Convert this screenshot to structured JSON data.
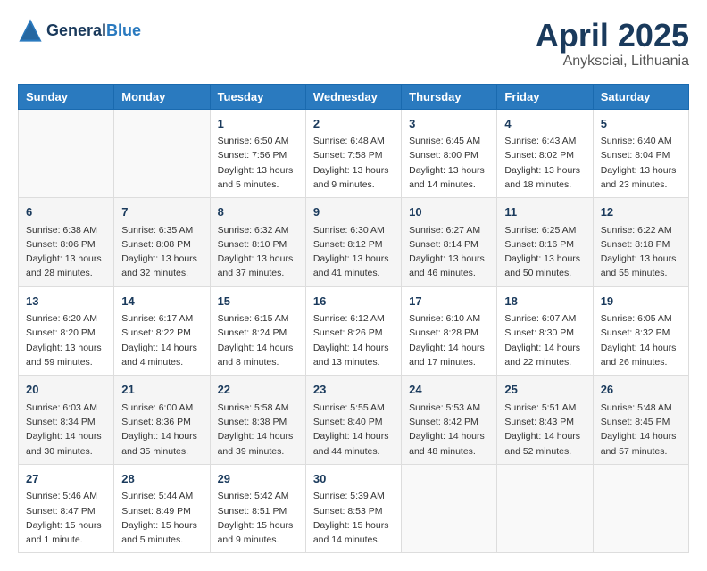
{
  "header": {
    "logo_general": "General",
    "logo_blue": "Blue",
    "month_title": "April 2025",
    "subtitle": "Anyksciai, Lithuania"
  },
  "days_of_week": [
    "Sunday",
    "Monday",
    "Tuesday",
    "Wednesday",
    "Thursday",
    "Friday",
    "Saturday"
  ],
  "weeks": [
    [
      {
        "day": "",
        "info": ""
      },
      {
        "day": "",
        "info": ""
      },
      {
        "day": "1",
        "info": "Sunrise: 6:50 AM\nSunset: 7:56 PM\nDaylight: 13 hours and 5 minutes."
      },
      {
        "day": "2",
        "info": "Sunrise: 6:48 AM\nSunset: 7:58 PM\nDaylight: 13 hours and 9 minutes."
      },
      {
        "day": "3",
        "info": "Sunrise: 6:45 AM\nSunset: 8:00 PM\nDaylight: 13 hours and 14 minutes."
      },
      {
        "day": "4",
        "info": "Sunrise: 6:43 AM\nSunset: 8:02 PM\nDaylight: 13 hours and 18 minutes."
      },
      {
        "day": "5",
        "info": "Sunrise: 6:40 AM\nSunset: 8:04 PM\nDaylight: 13 hours and 23 minutes."
      }
    ],
    [
      {
        "day": "6",
        "info": "Sunrise: 6:38 AM\nSunset: 8:06 PM\nDaylight: 13 hours and 28 minutes."
      },
      {
        "day": "7",
        "info": "Sunrise: 6:35 AM\nSunset: 8:08 PM\nDaylight: 13 hours and 32 minutes."
      },
      {
        "day": "8",
        "info": "Sunrise: 6:32 AM\nSunset: 8:10 PM\nDaylight: 13 hours and 37 minutes."
      },
      {
        "day": "9",
        "info": "Sunrise: 6:30 AM\nSunset: 8:12 PM\nDaylight: 13 hours and 41 minutes."
      },
      {
        "day": "10",
        "info": "Sunrise: 6:27 AM\nSunset: 8:14 PM\nDaylight: 13 hours and 46 minutes."
      },
      {
        "day": "11",
        "info": "Sunrise: 6:25 AM\nSunset: 8:16 PM\nDaylight: 13 hours and 50 minutes."
      },
      {
        "day": "12",
        "info": "Sunrise: 6:22 AM\nSunset: 8:18 PM\nDaylight: 13 hours and 55 minutes."
      }
    ],
    [
      {
        "day": "13",
        "info": "Sunrise: 6:20 AM\nSunset: 8:20 PM\nDaylight: 13 hours and 59 minutes."
      },
      {
        "day": "14",
        "info": "Sunrise: 6:17 AM\nSunset: 8:22 PM\nDaylight: 14 hours and 4 minutes."
      },
      {
        "day": "15",
        "info": "Sunrise: 6:15 AM\nSunset: 8:24 PM\nDaylight: 14 hours and 8 minutes."
      },
      {
        "day": "16",
        "info": "Sunrise: 6:12 AM\nSunset: 8:26 PM\nDaylight: 14 hours and 13 minutes."
      },
      {
        "day": "17",
        "info": "Sunrise: 6:10 AM\nSunset: 8:28 PM\nDaylight: 14 hours and 17 minutes."
      },
      {
        "day": "18",
        "info": "Sunrise: 6:07 AM\nSunset: 8:30 PM\nDaylight: 14 hours and 22 minutes."
      },
      {
        "day": "19",
        "info": "Sunrise: 6:05 AM\nSunset: 8:32 PM\nDaylight: 14 hours and 26 minutes."
      }
    ],
    [
      {
        "day": "20",
        "info": "Sunrise: 6:03 AM\nSunset: 8:34 PM\nDaylight: 14 hours and 30 minutes."
      },
      {
        "day": "21",
        "info": "Sunrise: 6:00 AM\nSunset: 8:36 PM\nDaylight: 14 hours and 35 minutes."
      },
      {
        "day": "22",
        "info": "Sunrise: 5:58 AM\nSunset: 8:38 PM\nDaylight: 14 hours and 39 minutes."
      },
      {
        "day": "23",
        "info": "Sunrise: 5:55 AM\nSunset: 8:40 PM\nDaylight: 14 hours and 44 minutes."
      },
      {
        "day": "24",
        "info": "Sunrise: 5:53 AM\nSunset: 8:42 PM\nDaylight: 14 hours and 48 minutes."
      },
      {
        "day": "25",
        "info": "Sunrise: 5:51 AM\nSunset: 8:43 PM\nDaylight: 14 hours and 52 minutes."
      },
      {
        "day": "26",
        "info": "Sunrise: 5:48 AM\nSunset: 8:45 PM\nDaylight: 14 hours and 57 minutes."
      }
    ],
    [
      {
        "day": "27",
        "info": "Sunrise: 5:46 AM\nSunset: 8:47 PM\nDaylight: 15 hours and 1 minute."
      },
      {
        "day": "28",
        "info": "Sunrise: 5:44 AM\nSunset: 8:49 PM\nDaylight: 15 hours and 5 minutes."
      },
      {
        "day": "29",
        "info": "Sunrise: 5:42 AM\nSunset: 8:51 PM\nDaylight: 15 hours and 9 minutes."
      },
      {
        "day": "30",
        "info": "Sunrise: 5:39 AM\nSunset: 8:53 PM\nDaylight: 15 hours and 14 minutes."
      },
      {
        "day": "",
        "info": ""
      },
      {
        "day": "",
        "info": ""
      },
      {
        "day": "",
        "info": ""
      }
    ]
  ]
}
